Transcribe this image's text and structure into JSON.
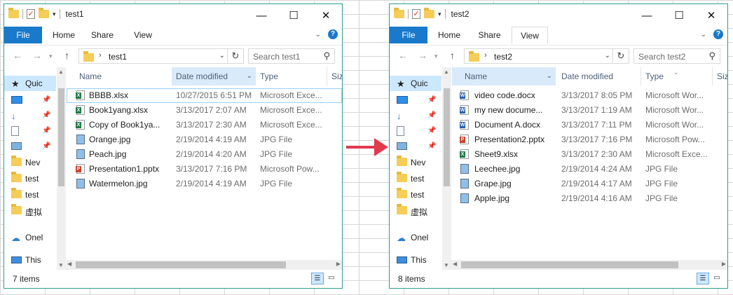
{
  "colors": {
    "window_border": "#2d9c8c",
    "file_tab": "#1979ca",
    "selection": "#cce8ff",
    "arrow": "#e03a4f"
  },
  "windows": [
    {
      "title": "test1",
      "ribbon": {
        "tabs": [
          "File",
          "Home",
          "Share",
          "View"
        ],
        "selected_tab": "View"
      },
      "address": {
        "crumb": "test1"
      },
      "search": {
        "placeholder": "Search test1"
      },
      "nav": [
        {
          "label": "Quic",
          "icon": "star-icon"
        },
        {
          "label": "",
          "icon": "desktop-icon"
        },
        {
          "label": "",
          "icon": "downloads-icon"
        },
        {
          "label": "",
          "icon": "documents-icon"
        },
        {
          "label": "",
          "icon": "pictures-icon"
        },
        {
          "label": "Nev",
          "icon": "folder-icon"
        },
        {
          "label": "test",
          "icon": "folder-icon"
        },
        {
          "label": "test",
          "icon": "folder-icon"
        },
        {
          "label": "虚拟",
          "icon": "folder-icon"
        },
        {
          "label": "Onel",
          "icon": "onedrive-icon"
        },
        {
          "label": "This",
          "icon": "this-pc-icon"
        }
      ],
      "columns": {
        "name": "Name",
        "date": "Date modified",
        "type": "Type",
        "size": "Size"
      },
      "sorted_column": "date",
      "files": [
        {
          "name": "BBBB.xlsx",
          "date": "10/27/2015 6:51 PM",
          "type": "Microsoft Exce...",
          "kind": "xlsx"
        },
        {
          "name": "Book1yang.xlsx",
          "date": "3/13/2017 2:07 AM",
          "type": "Microsoft Exce...",
          "kind": "xlsx"
        },
        {
          "name": "Copy of Book1ya...",
          "date": "3/13/2017 2:30 AM",
          "type": "Microsoft Exce...",
          "kind": "xlsx"
        },
        {
          "name": "Orange.jpg",
          "date": "2/19/2014 4:19 AM",
          "type": "JPG File",
          "kind": "jpg"
        },
        {
          "name": "Peach.jpg",
          "date": "2/19/2014 4:20 AM",
          "type": "JPG File",
          "kind": "jpg"
        },
        {
          "name": "Presentation1.pptx",
          "date": "3/13/2017 7:16 PM",
          "type": "Microsoft Pow...",
          "kind": "pptx"
        },
        {
          "name": "Watermelon.jpg",
          "date": "2/19/2014 4:19 AM",
          "type": "JPG File",
          "kind": "jpg"
        }
      ],
      "status": "7 items"
    },
    {
      "title": "test2",
      "ribbon": {
        "tabs": [
          "File",
          "Home",
          "Share",
          "View"
        ],
        "selected_tab": "View"
      },
      "address": {
        "crumb": "test2"
      },
      "search": {
        "placeholder": "Search test2"
      },
      "nav": [
        {
          "label": "Quic",
          "icon": "star-icon"
        },
        {
          "label": "",
          "icon": "desktop-icon"
        },
        {
          "label": "",
          "icon": "downloads-icon"
        },
        {
          "label": "",
          "icon": "documents-icon"
        },
        {
          "label": "",
          "icon": "pictures-icon"
        },
        {
          "label": "Nev",
          "icon": "folder-icon"
        },
        {
          "label": "test",
          "icon": "folder-icon"
        },
        {
          "label": "test",
          "icon": "folder-icon"
        },
        {
          "label": "虚拟",
          "icon": "folder-icon"
        },
        {
          "label": "Onel",
          "icon": "onedrive-icon"
        },
        {
          "label": "This",
          "icon": "this-pc-icon"
        }
      ],
      "columns": {
        "name": "Name",
        "date": "Date modified",
        "type": "Type",
        "size": "Size"
      },
      "sorted_column": "name",
      "files": [
        {
          "name": "video code.docx",
          "date": "3/13/2017 8:05 PM",
          "type": "Microsoft Wor...",
          "kind": "docx"
        },
        {
          "name": "my new docume...",
          "date": "3/13/2017 1:19 AM",
          "type": "Microsoft Wor...",
          "kind": "docx"
        },
        {
          "name": "Document A.docx",
          "date": "3/13/2017 7:11 PM",
          "type": "Microsoft Wor...",
          "kind": "docx"
        },
        {
          "name": "Presentation2.pptx",
          "date": "3/13/2017 7:16 PM",
          "type": "Microsoft Pow...",
          "kind": "pptx"
        },
        {
          "name": "Sheet9.xlsx",
          "date": "3/13/2017 2:30 AM",
          "type": "Microsoft Exce...",
          "kind": "xlsx"
        },
        {
          "name": "Leechee.jpg",
          "date": "2/19/2014 4:24 AM",
          "type": "JPG File",
          "kind": "jpg"
        },
        {
          "name": "Grape.jpg",
          "date": "2/19/2014 4:17 AM",
          "type": "JPG File",
          "kind": "jpg"
        },
        {
          "name": "Apple.jpg",
          "date": "2/19/2014 4:16 AM",
          "type": "JPG File",
          "kind": "jpg"
        }
      ],
      "status": "8 items"
    }
  ]
}
